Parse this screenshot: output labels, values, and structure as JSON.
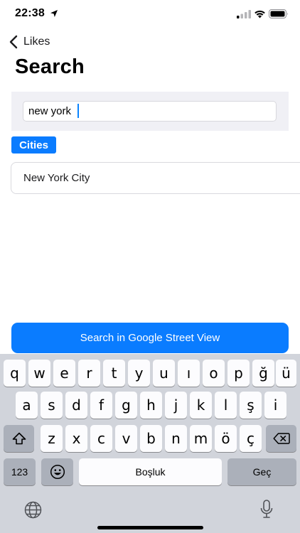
{
  "status_bar": {
    "time": "22:38",
    "icons": [
      "location-arrow-icon",
      "cellular-signal-icon",
      "wifi-icon",
      "battery-icon"
    ]
  },
  "nav": {
    "back_label": "Likes",
    "back_icon": "chevron-left-icon"
  },
  "page": {
    "title": "Search"
  },
  "search": {
    "value": "new york",
    "placeholder": ""
  },
  "filters": {
    "active_chip": "Cities"
  },
  "results": [
    {
      "label": "New York City"
    }
  ],
  "primary_action": {
    "label": "Search in Google Street View"
  },
  "keyboard": {
    "row1": [
      "q",
      "w",
      "e",
      "r",
      "t",
      "y",
      "u",
      "ı",
      "o",
      "p",
      "ğ",
      "ü"
    ],
    "row2": [
      "a",
      "s",
      "d",
      "f",
      "g",
      "h",
      "j",
      "k",
      "l",
      "ş",
      "i"
    ],
    "row3": [
      "z",
      "x",
      "c",
      "v",
      "b",
      "n",
      "m",
      "ö",
      "ç"
    ],
    "numbers_label": "123",
    "space_label": "Boşluk",
    "return_label": "Geç",
    "icons": [
      "shift-icon",
      "delete-icon",
      "emoji-icon",
      "globe-icon",
      "microphone-icon"
    ]
  },
  "colors": {
    "accent": "#0a7cff",
    "keyboard_bg": "#d1d4db",
    "key_bg": "#fcfcfe",
    "function_key_bg": "#abb0ba"
  }
}
